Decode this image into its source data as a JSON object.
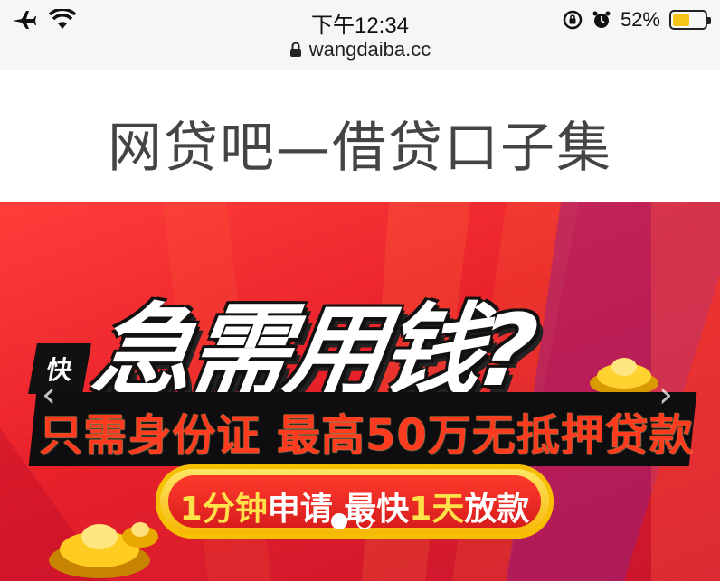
{
  "status_bar": {
    "time": "下午12:34",
    "url": "wangdaiba.cc",
    "battery_percent": "52%",
    "battery_level": 0.52,
    "icons": [
      "airplane-icon",
      "wifi-icon",
      "lock-icon",
      "rotation-lock-icon",
      "alarm-icon",
      "battery-icon"
    ]
  },
  "page": {
    "title": "网贷吧—借贷口子集"
  },
  "banner": {
    "tag": "快",
    "headline": "急需用钱?",
    "subline": "只需身份证 最高50万无抵押贷款",
    "pill_part1": "1分钟",
    "pill_part2": "申请",
    "pill_part3": "最快",
    "pill_part4": "1天",
    "pill_part5": "放款",
    "prev_arrow": "‹",
    "next_arrow": "›",
    "carousel_index": 1,
    "carousel_count": 2,
    "colors": {
      "background": "#e8212a",
      "accent": "#f6c000",
      "text_red": "#ff3b1f"
    }
  }
}
